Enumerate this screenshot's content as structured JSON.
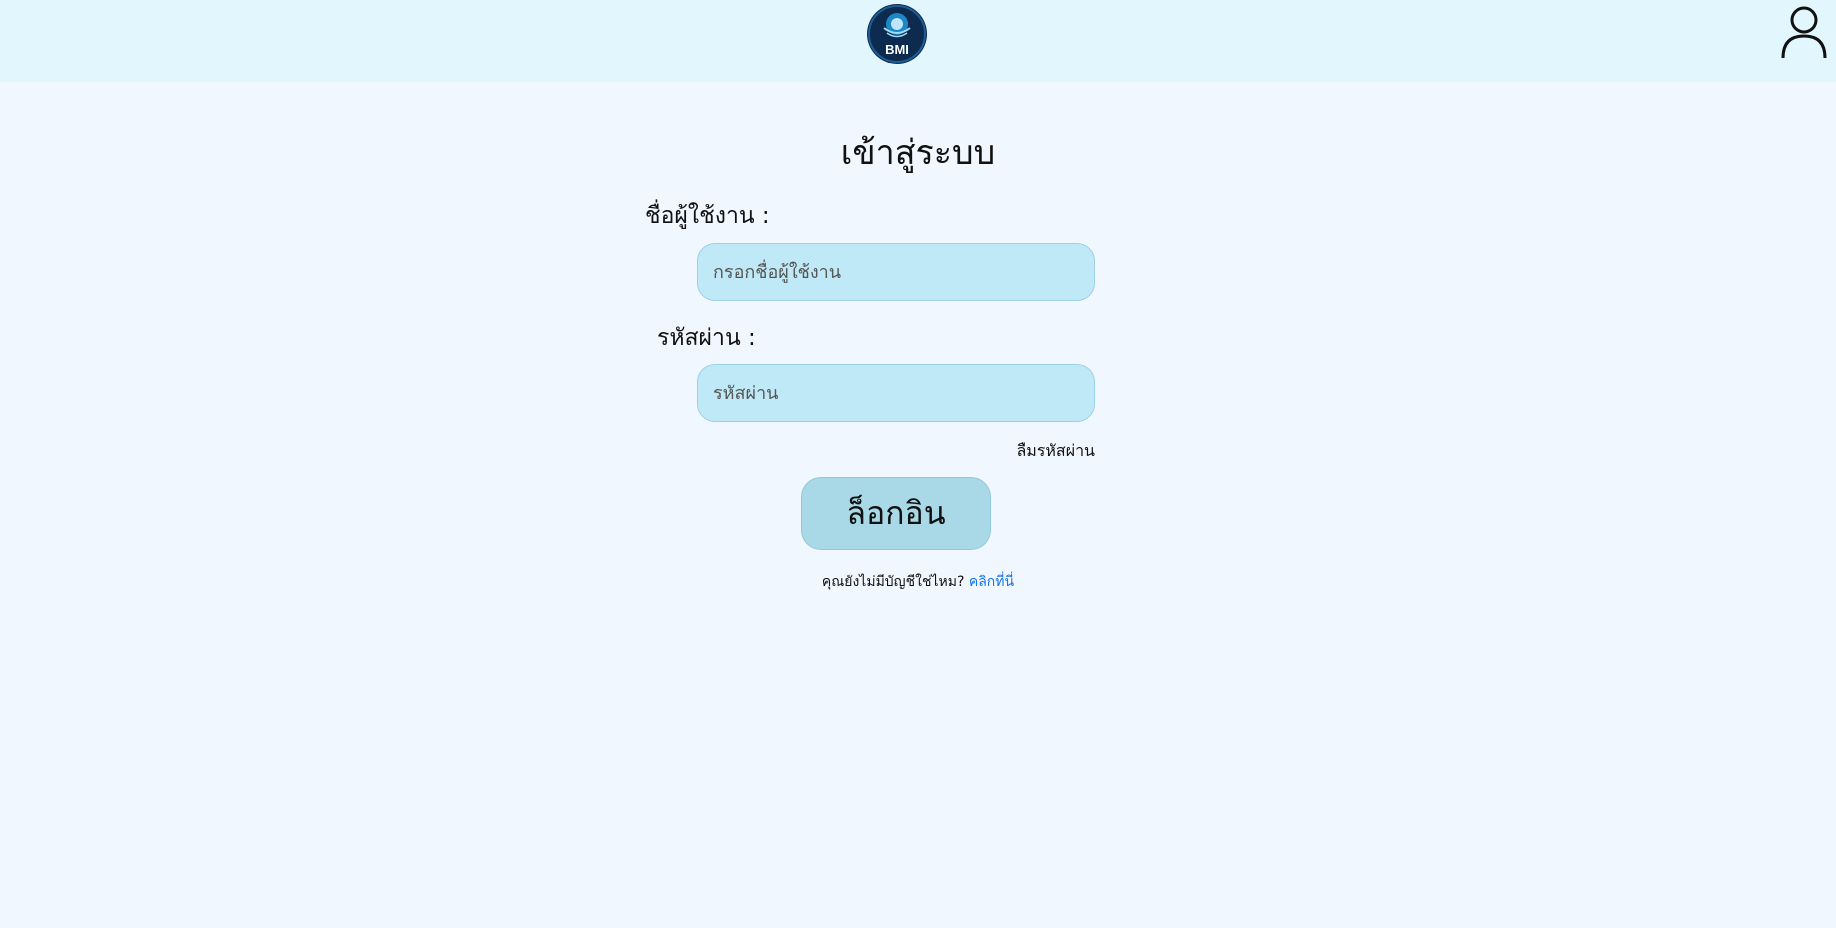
{
  "header": {
    "logo_text": "BMI",
    "logo_icon": "bmi-logo",
    "user_icon": "user-icon"
  },
  "login": {
    "title": "เข้าสู่ระบบ",
    "username_label": "ชื่อผู้ใช้งาน :",
    "username_placeholder": "กรอกชื่อผู้ใช้งาน",
    "username_value": "",
    "password_label": "รหัสผ่าน :",
    "password_placeholder": "รหัสผ่าน",
    "password_value": "",
    "forgot_password": "ลืมรหัสผ่าน",
    "submit_label": "ล็อกอิน",
    "no_account_text": "คุณยังไม่มีบัญชีใช่ไหม?",
    "signup_link": "คลิกที่นี่"
  },
  "colors": {
    "page_background": "#f1f7fe",
    "header_background": "#e2f6fe",
    "input_background": "#c0e9f7",
    "button_background": "#a9d9e6",
    "link": "#1a73e8",
    "logo_background": "#0d2a4f"
  }
}
